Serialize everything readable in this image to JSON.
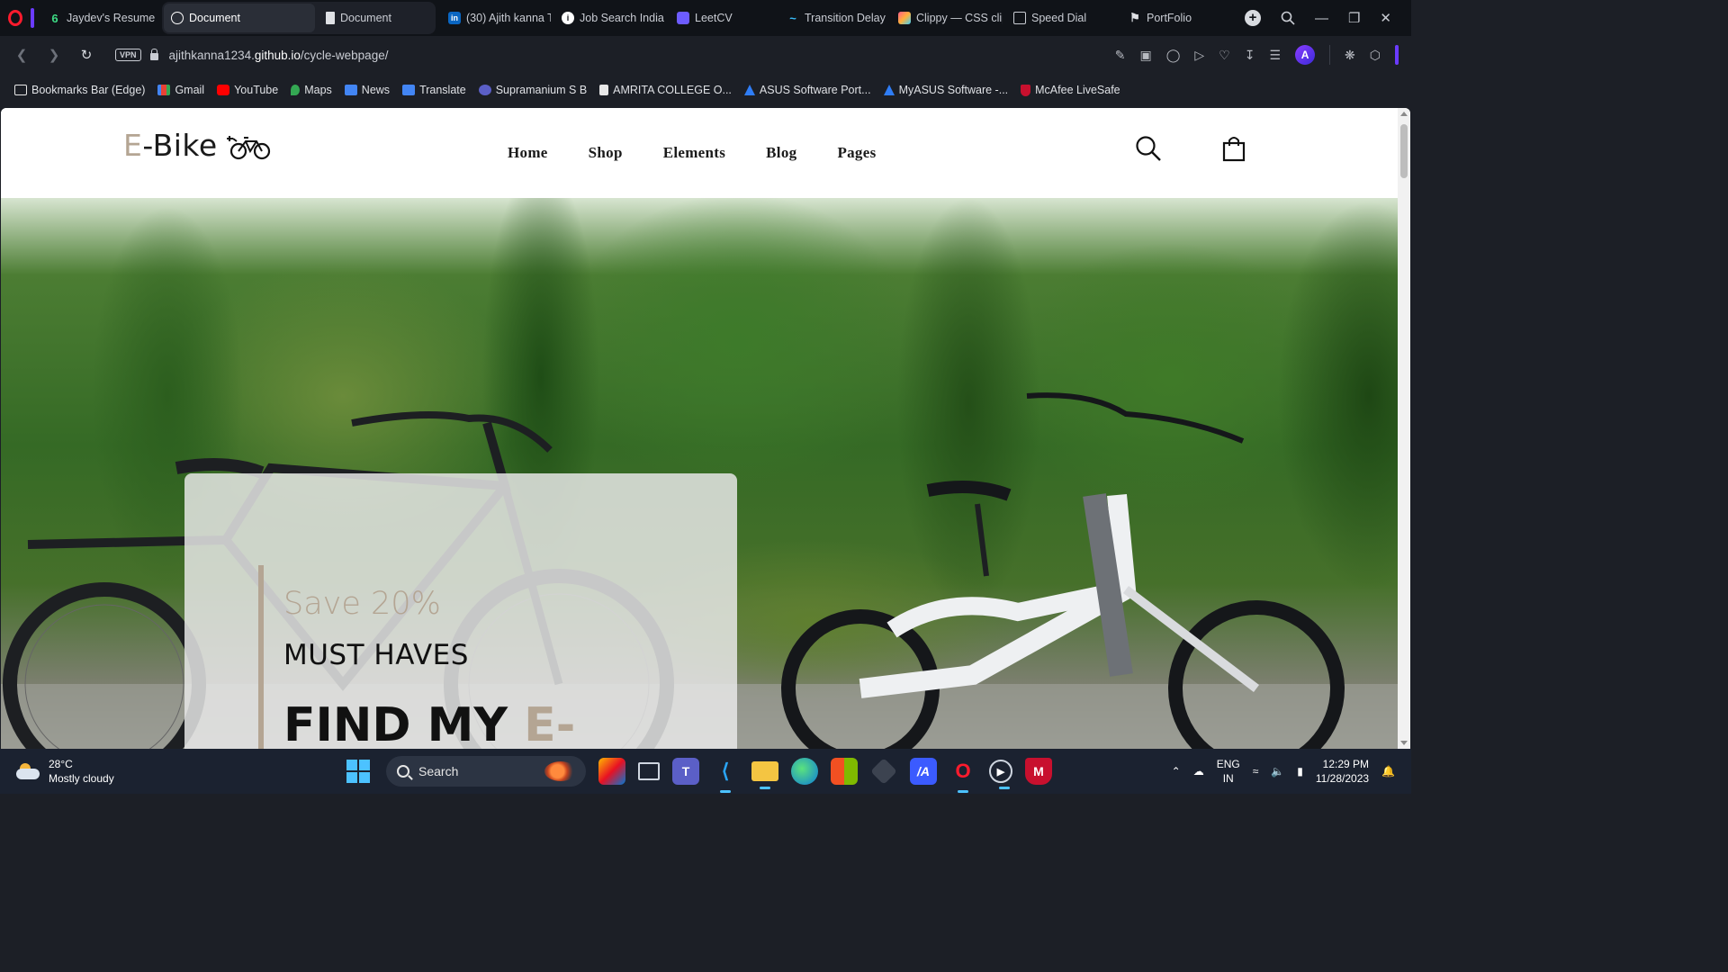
{
  "browser": {
    "tabs": [
      {
        "label": "Jaydev's Resume",
        "icon": "green-leaf-icon",
        "active": false
      },
      {
        "label": "Document",
        "icon": "globe-icon",
        "active": true
      },
      {
        "label": "Document",
        "icon": "document-icon",
        "active": false
      },
      {
        "label": "(30) Ajith kanna T",
        "icon": "linkedin-icon",
        "active": false
      },
      {
        "label": "Job Search India |",
        "icon": "info-icon",
        "active": false
      },
      {
        "label": "LeetCV",
        "icon": "leetcv-icon",
        "active": false
      },
      {
        "label": "Transition Delay -",
        "icon": "tailwind-icon",
        "active": false
      },
      {
        "label": "Clippy — CSS clip",
        "icon": "clippy-icon",
        "active": false
      },
      {
        "label": "Speed Dial",
        "icon": "speed-dial-icon",
        "active": false
      },
      {
        "label": "PortFolio",
        "icon": "portfolio-icon",
        "active": false
      }
    ],
    "address": {
      "vpn_label": "VPN",
      "url_prefix": "ajithkanna1234.",
      "url_domain": "github.io",
      "url_path": "/cycle-webpage/"
    },
    "bookmarks": [
      {
        "label": "Bookmarks Bar (Edge)",
        "icon": "folder-icon",
        "color": "#e8e8e8"
      },
      {
        "label": "Gmail",
        "icon": "gmail-icon",
        "color": "#ea4335"
      },
      {
        "label": "YouTube",
        "icon": "youtube-icon",
        "color": "#ff0000"
      },
      {
        "label": "Maps",
        "icon": "maps-icon",
        "color": "#34a853"
      },
      {
        "label": "News",
        "icon": "news-icon",
        "color": "#4285f4"
      },
      {
        "label": "Translate",
        "icon": "translate-icon",
        "color": "#4285f4"
      },
      {
        "label": "Supramanium S B",
        "icon": "link-icon",
        "color": "#5b5fc7"
      },
      {
        "label": "AMRITA COLLEGE O...",
        "icon": "page-icon",
        "color": "#e8e8e8"
      },
      {
        "label": "ASUS Software Port...",
        "icon": "asus-icon",
        "color": "#2f7df6"
      },
      {
        "label": "MyASUS Software -...",
        "icon": "asus-icon",
        "color": "#2f7df6"
      },
      {
        "label": "McAfee LiveSafe",
        "icon": "mcafee-icon",
        "color": "#c8102e"
      }
    ]
  },
  "site": {
    "logo_accent": "E",
    "logo_rest": "-Bike",
    "nav": [
      "Home",
      "Shop",
      "Elements",
      "Blog",
      "Pages"
    ],
    "promo": {
      "save": "Save 20%",
      "tagline": "MUST HAVES",
      "headline": "FIND MY ",
      "headline_accent": "E-"
    },
    "accent_color": "#b4a593"
  },
  "taskbar": {
    "weather_temp": "28°C",
    "weather_desc": "Mostly cloudy",
    "search_label": "Search",
    "lang_top": "ENG",
    "lang_bottom": "IN",
    "time": "12:29 PM",
    "date": "11/28/2023"
  }
}
